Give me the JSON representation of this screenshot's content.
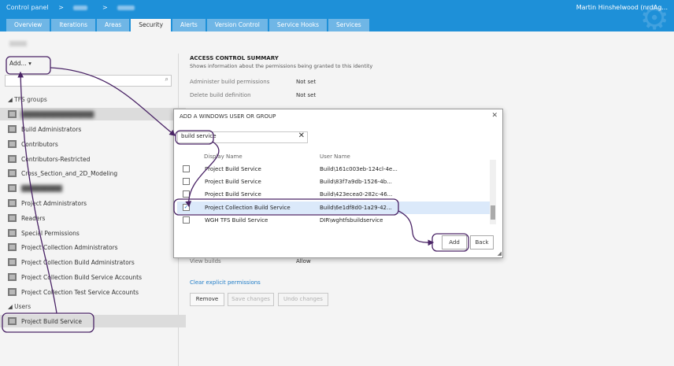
{
  "header": {
    "crumbs": [
      "Control panel",
      ">",
      ">"
    ],
    "user": "Martin Hinshelwood (nrdAg..."
  },
  "tabs": [
    "Overview",
    "Iterations",
    "Areas",
    "Security",
    "Alerts",
    "Version Control",
    "Service Hooks",
    "Services"
  ],
  "left": {
    "add_label": "Add...",
    "search_icon": "search-icon",
    "tfs_groups_label": "TFS groups",
    "groups": [
      "Build Administrators",
      "Contributors",
      "Contributors-Restricted",
      "Cross_Section_and_2D_Modeling",
      "Project Administrators",
      "Readers",
      "Special Permissions",
      "Project Collection Administrators",
      "Project Collection Build Administrators",
      "Project Collection Build Service Accounts",
      "Project Collection Test Service Accounts"
    ],
    "users_label": "Users",
    "user_item": "Project Build Service"
  },
  "right": {
    "title": "ACCESS CONTROL SUMMARY",
    "subtitle": "Shows information about the permissions being granted to this identity",
    "perms": [
      {
        "name": "Administer build permissions",
        "value": "Not set"
      },
      {
        "name": "Delete build definition",
        "value": "Not set"
      },
      {
        "name": "View builds",
        "value": "Allow"
      }
    ],
    "clear_link": "Clear explicit permissions",
    "buttons": [
      "Remove",
      "Save changes",
      "Undo changes"
    ]
  },
  "dialog": {
    "title": "ADD A WINDOWS USER OR GROUP",
    "search_value": "build service",
    "col_display": "Display Name",
    "col_user": "User Name",
    "rows": [
      {
        "display": "Project Build Service",
        "user": "Build\\161c003eb-124cl-4e..."
      },
      {
        "display": "Project Build Service",
        "user": "Build\\83f7a9db-1526-4b..."
      },
      {
        "display": "Project Build Service",
        "user": "Build\\423ecea0-282c-46..."
      },
      {
        "display": "Project Collection Build Service",
        "user": "Build\\6e1df8d0-1a29-42..."
      },
      {
        "display": "WGH TFS Build Service",
        "user": "DIR\\wghtfsbuildservice"
      }
    ],
    "add_label": "Add",
    "back_label": "Back"
  },
  "colors": {
    "header": "#1e90d8",
    "annotation": "#4a2466",
    "selected_row": "#dbe9fa"
  }
}
